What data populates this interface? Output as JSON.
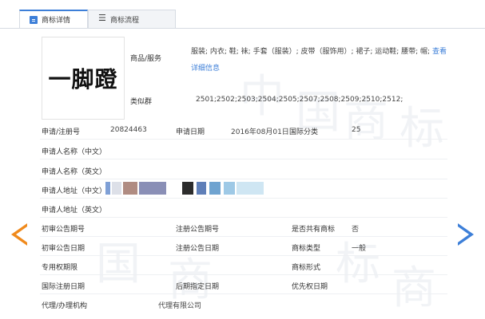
{
  "tabs": [
    {
      "label": "商标详情",
      "active": true,
      "icon": "detail-icon"
    },
    {
      "label": "商标流程",
      "active": false,
      "icon": "list-icon"
    }
  ],
  "watermark": [
    "中",
    "国",
    "商",
    "标"
  ],
  "logo": {
    "text": "一脚蹬"
  },
  "goods": {
    "label": "商品/服务",
    "value": "服装; 内衣; 鞋; 袜; 手套（服装）; 皮带（服饰用）; 裙子; 运动鞋; 腰带; 帽; ",
    "link": "查看详细信息"
  },
  "similar_group": {
    "label": "类似群",
    "value": "2501;2502;2503;2504;2505;2507;2508;2509;2510;2512;"
  },
  "fields": {
    "reg_no": {
      "label": "申请/注册号",
      "value": "20824463"
    },
    "app_date": {
      "label": "申请日期",
      "value": "2016年08月01日"
    },
    "intl_class": {
      "label": "国际分类",
      "value": "25"
    },
    "applicant_cn": {
      "label": "申请人名称（中文）",
      "value": ""
    },
    "applicant_en": {
      "label": "申请人名称（英文）",
      "value": ""
    },
    "address_cn": {
      "label": "申请人地址（中文）",
      "value": ""
    },
    "address_en": {
      "label": "申请人地址（英文）",
      "value": ""
    },
    "prelim_pub_no": {
      "label": "初审公告期号",
      "value": ""
    },
    "reg_pub_no": {
      "label": "注册公告期号",
      "value": ""
    },
    "shared": {
      "label": "是否共有商标",
      "value": "否"
    },
    "prelim_pub_date": {
      "label": "初审公告日期",
      "value": ""
    },
    "reg_pub_date": {
      "label": "注册公告日期",
      "value": ""
    },
    "tm_type": {
      "label": "商标类型",
      "value": "一般"
    },
    "exclusive_period": {
      "label": "专用权期限",
      "value": ""
    },
    "tm_form": {
      "label": "商标形式",
      "value": ""
    },
    "intl_reg_date": {
      "label": "国际注册日期",
      "value": ""
    },
    "later_date": {
      "label": "后期指定日期",
      "value": ""
    },
    "priority_date": {
      "label": "优先权日期",
      "value": ""
    },
    "agent": {
      "label": "代理/办理机构",
      "value": "代理有限公司"
    }
  },
  "redaction_colors": [
    "#7fa0d6",
    "#b08c82",
    "#8a8fb6",
    "#c7ccd8",
    "#2c2c2c",
    "#5f7fb8",
    "#9ec9e6",
    "#6fa3d0",
    "#cfe6f3"
  ],
  "colors": {
    "accent": "#3d7fd8",
    "prev_arrow": "#f08a1c",
    "next_arrow": "#3d7fd8"
  }
}
